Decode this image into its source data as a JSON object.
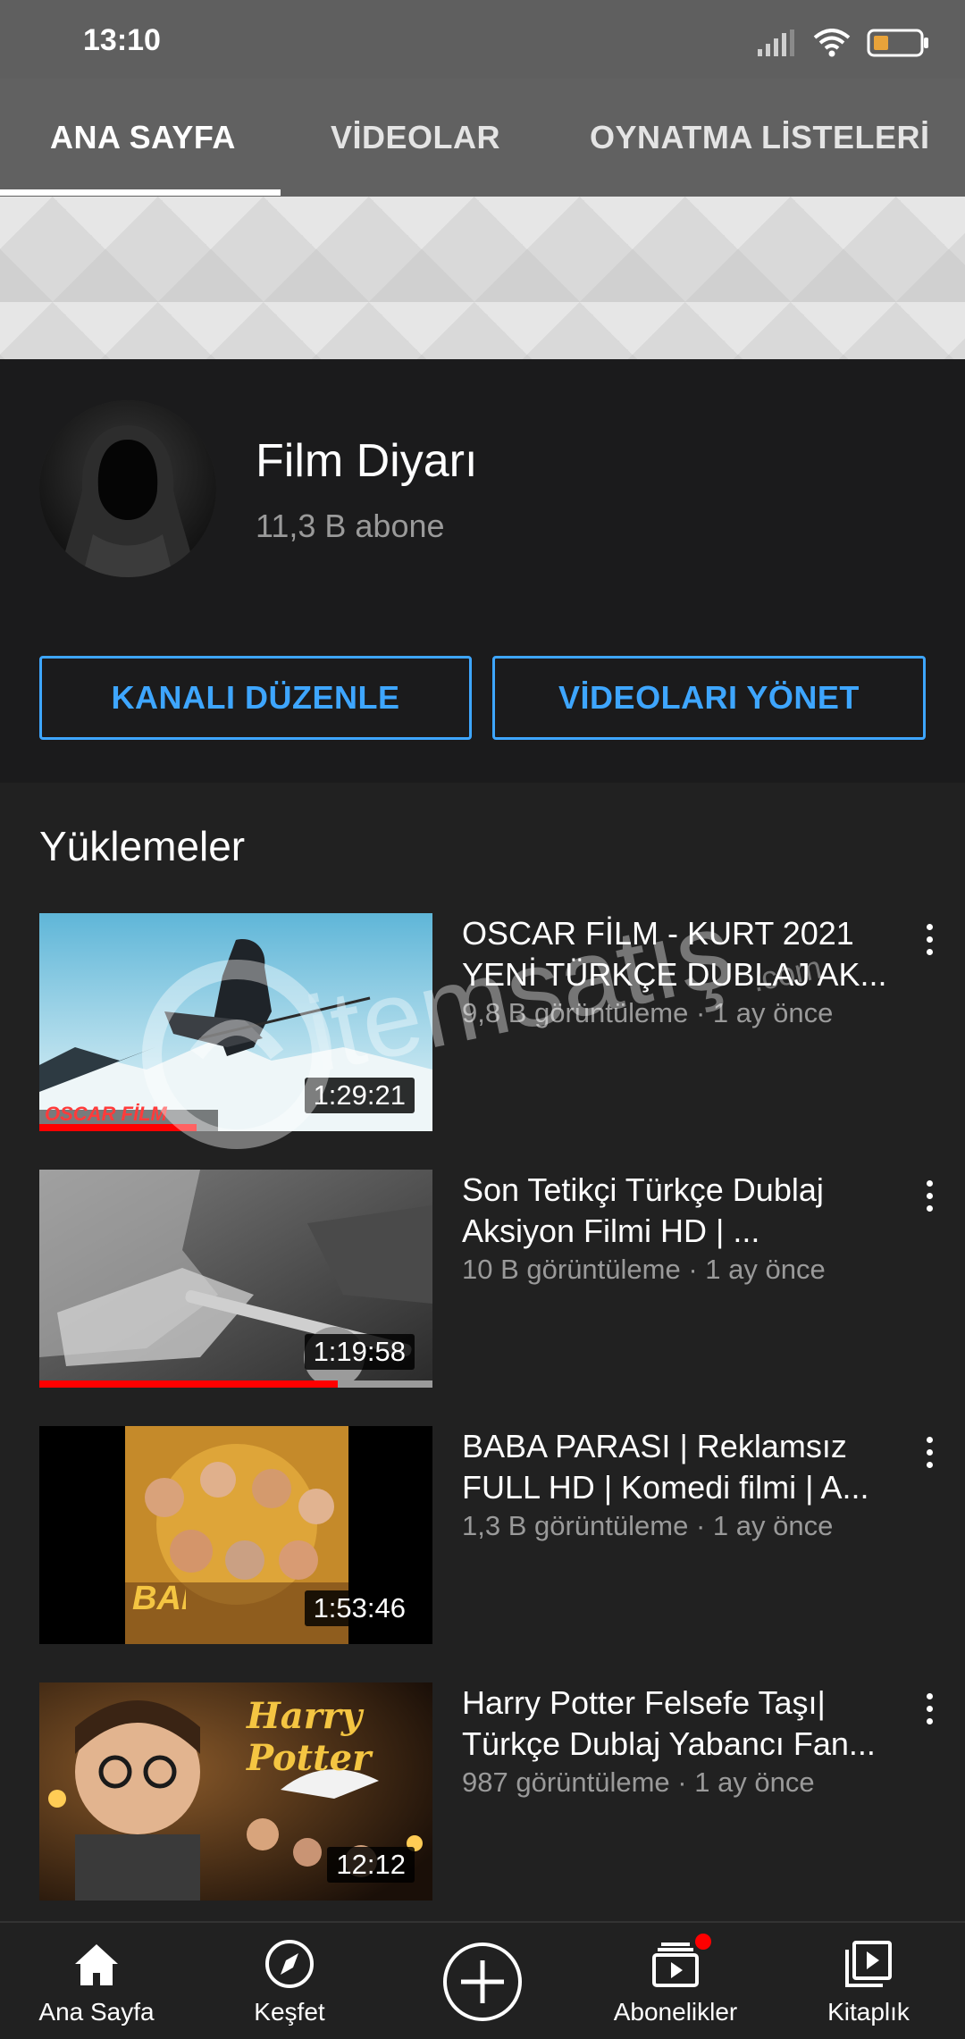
{
  "status": {
    "time": "13:10",
    "icons": [
      "signal-icon",
      "wifi-icon",
      "battery-icon"
    ],
    "battery_color": "#e8a33a"
  },
  "tabs": [
    {
      "label": "ANA SAYFA",
      "active": true
    },
    {
      "label": "VİDEOLAR",
      "active": false
    },
    {
      "label": "OYNATMA LİSTELERİ",
      "active": false
    }
  ],
  "channel": {
    "name": "Film Diyarı",
    "subscribers": "11,3 B abone",
    "edit_button": "KANALI DÜZENLE",
    "manage_button": "VİDEOLARI YÖNET"
  },
  "uploads": {
    "section_title": "Yüklemeler",
    "videos": [
      {
        "title": "OSCAR FİLM - KURT 2021 YENİ TÜRKÇE DUBLAJ AK...",
        "meta": "9,8 B görüntüleme · 1 ay önce",
        "duration": "1:29:21",
        "thumb_text": "OSCAR FİLM",
        "progress": 0.4
      },
      {
        "title": "Son Tetikçi Türkçe Dublaj Aksiyon Filmi HD | ...",
        "meta": "10 B görüntüleme · 1 ay önce",
        "duration": "1:19:58",
        "progress": 0.76
      },
      {
        "title": "BABA PARASI | Reklamsız FULL HD | Komedi filmi | A...",
        "meta": "1,3 B görüntüleme · 1 ay önce",
        "duration": "1:53:46",
        "thumb_text": "BABA PARASI"
      },
      {
        "title": "Harry Potter Felsefe Taşı| Türkçe Dublaj Yabancı Fan...",
        "meta": "987 görüntüleme · 1 ay önce",
        "duration": "12:12",
        "thumb_text": "Harry Potter"
      }
    ]
  },
  "watermark": {
    "text": "itemsatış",
    "sub": ".com"
  },
  "bottom_nav": [
    {
      "label": "Ana Sayfa",
      "icon": "home-icon"
    },
    {
      "label": "Keşfet",
      "icon": "compass-icon"
    },
    {
      "label": "",
      "icon": "create-icon"
    },
    {
      "label": "Abonelikler",
      "icon": "subscriptions-icon",
      "badge_color": "#ff0000"
    },
    {
      "label": "Kitaplık",
      "icon": "library-icon"
    }
  ],
  "colors": {
    "accent": "#3ea6ff",
    "progress": "#ff0000",
    "background": "#212121"
  }
}
